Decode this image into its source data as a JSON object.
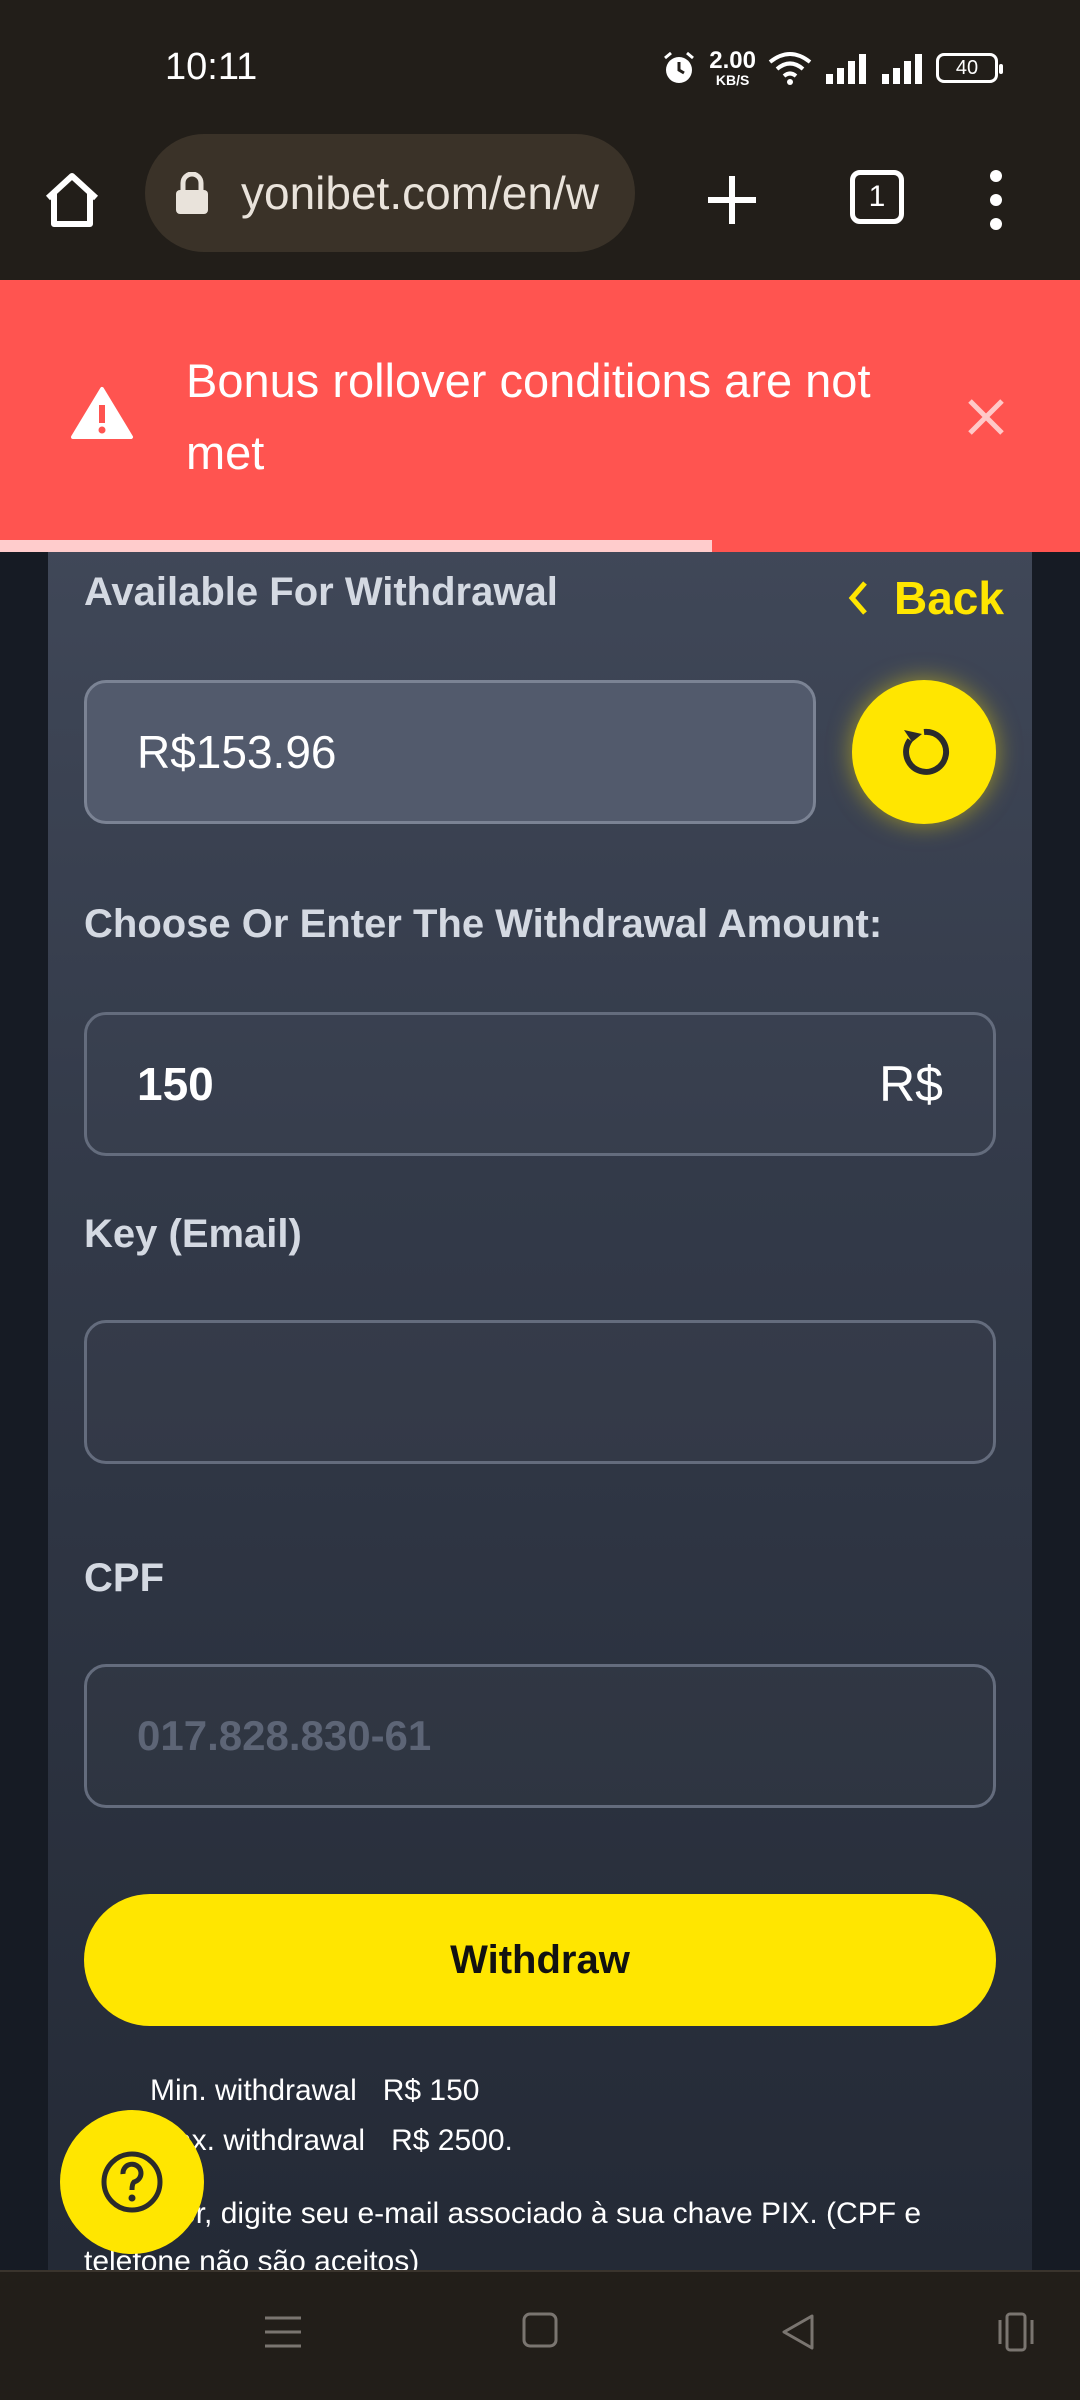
{
  "status_bar": {
    "time": "10:11",
    "net_speed_value": "2.00",
    "net_speed_unit": "KB/S",
    "battery": "40"
  },
  "browser": {
    "url": "yonibet.com/en/w",
    "tab_count": "1"
  },
  "alert": {
    "message": "Bonus rollover conditions are not met",
    "color": "#ff5450"
  },
  "form": {
    "available_label": "Available For Withdrawal",
    "back_label": "Back",
    "balance": "R$153.96",
    "amount_label": "Choose Or Enter The Withdrawal Amount:",
    "amount_value": "150",
    "currency": "R$",
    "key_label": "Key (Email)",
    "key_value": "",
    "cpf_label": "CPF",
    "cpf_placeholder": "017.828.830-61",
    "withdraw_label": "Withdraw"
  },
  "limits": {
    "min_label": "Min. withdrawal",
    "min_value": "R$ 150",
    "max_label": "Max. withdrawal",
    "max_value": "R$ 2500."
  },
  "info": "Por favor, digite seu e-mail associado à sua chave PIX. (CPF e telefone não são aceitos)",
  "colors": {
    "accent": "#ffe600",
    "panel": "#3a4150"
  }
}
